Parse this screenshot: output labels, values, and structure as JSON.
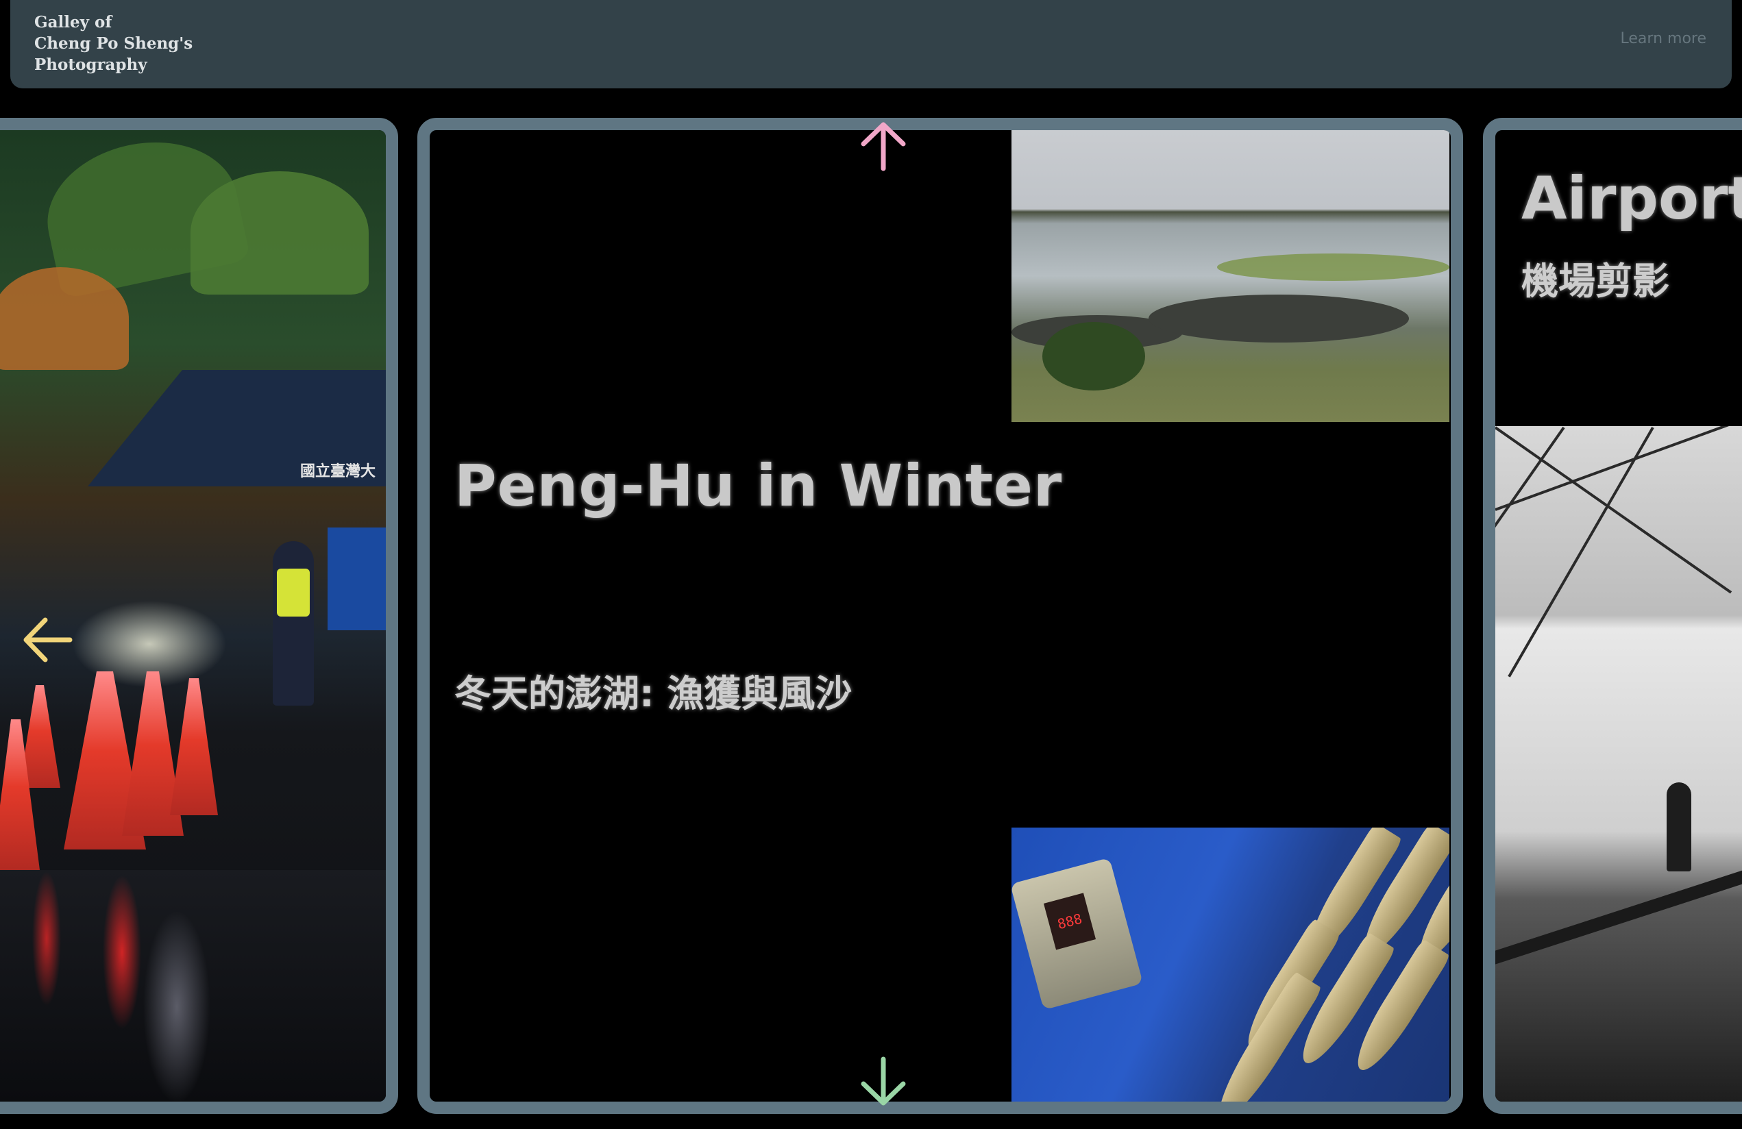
{
  "header": {
    "site_title": "Galley of\nCheng Po Sheng's\nPhotography",
    "learn_more_label": "Learn more"
  },
  "cards": {
    "main": {
      "title": "Peng-Hu in Winter",
      "subtitle": "冬天的澎湖: 漁獲與風沙"
    },
    "right": {
      "title": "Airport",
      "subtitle": "機場剪影"
    },
    "left": {
      "sign_text": "國立臺灣大"
    }
  },
  "colors": {
    "header_bg": "#334249",
    "card_border": "#5f7683",
    "arrow_up": "#f1a7c8",
    "arrow_down": "#9ad6a6",
    "arrow_left": "#f2d57a"
  },
  "icons": {
    "up": "arrow-up-icon",
    "down": "arrow-down-icon",
    "left": "arrow-left-icon"
  }
}
